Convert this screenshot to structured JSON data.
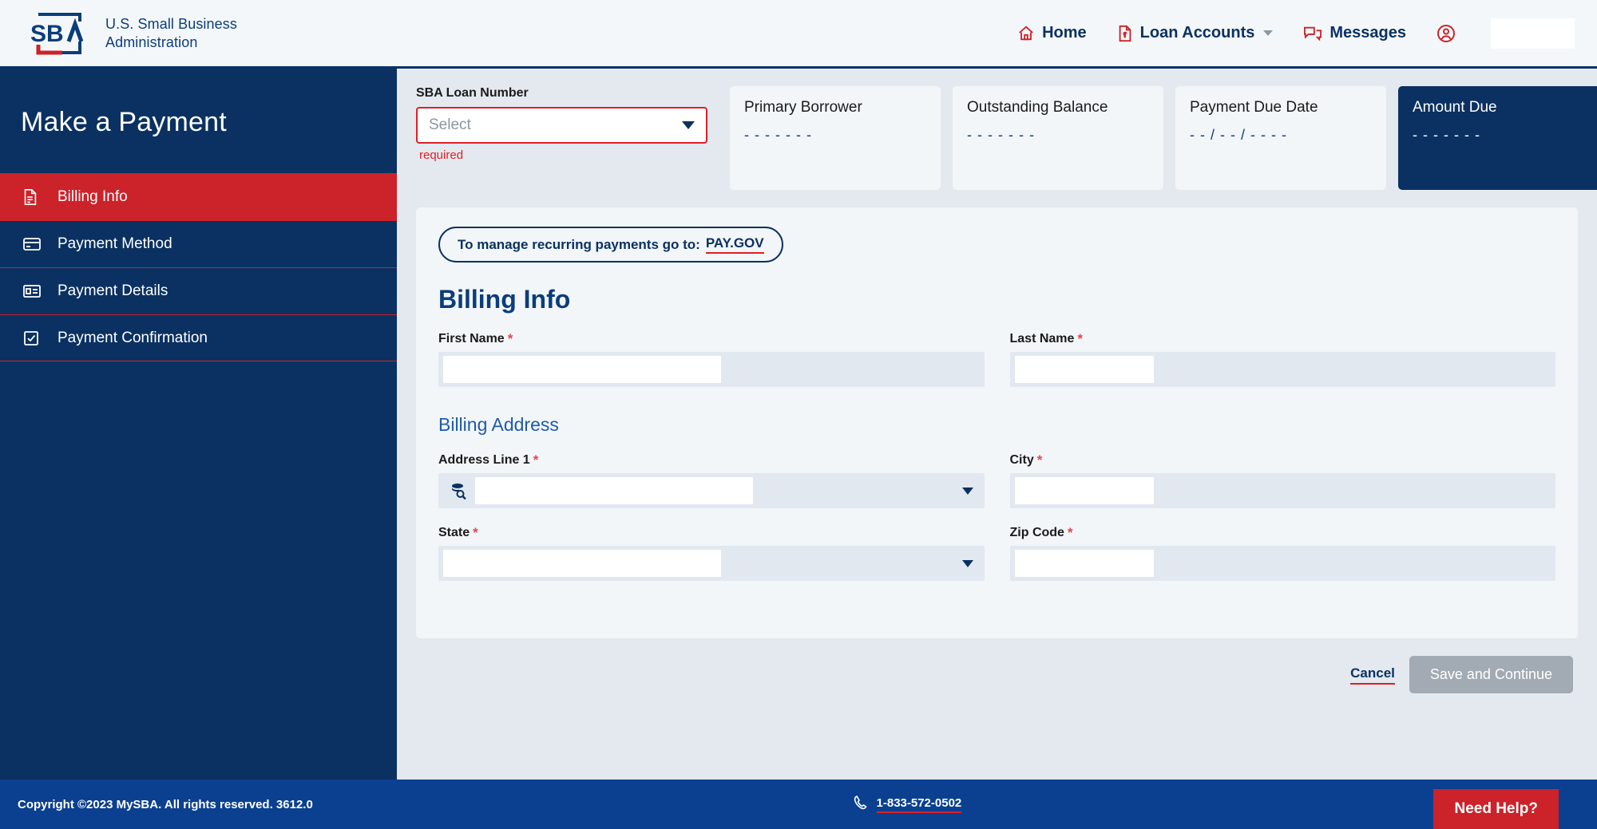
{
  "header": {
    "logo_alt": "SBA",
    "agency_line1": "U.S. Small Business",
    "agency_line2": "Administration",
    "nav": [
      {
        "label": "Home",
        "icon": "home-icon"
      },
      {
        "label": "Loan Accounts",
        "icon": "document-icon",
        "has_caret": true
      },
      {
        "label": "Messages",
        "icon": "messages-icon"
      }
    ],
    "user_name": ""
  },
  "sidebar": {
    "title": "Make a Payment",
    "items": [
      {
        "label": "Billing Info",
        "icon": "document-icon",
        "active": true
      },
      {
        "label": "Payment Method",
        "icon": "credit-card-icon",
        "active": false
      },
      {
        "label": "Payment Details",
        "icon": "payment-details-icon",
        "active": false
      },
      {
        "label": "Payment Confirmation",
        "icon": "checkbox-icon",
        "active": false
      }
    ]
  },
  "summary": {
    "loan_number_label": "SBA Loan Number",
    "loan_number_placeholder": "Select",
    "loan_number_error": "required",
    "cards": [
      {
        "title": "Primary Borrower",
        "value": "- - - - - - -"
      },
      {
        "title": "Outstanding Balance",
        "value": "- - - - - - -"
      },
      {
        "title": "Payment Due Date",
        "value": "- - / - - / - - - -"
      },
      {
        "title": "Amount Due",
        "value": "- - - - - - -",
        "dark": true
      }
    ]
  },
  "panel": {
    "recurring_notice_text": "To manage recurring payments go to:",
    "recurring_notice_link": "PAY.GOV",
    "heading": "Billing Info",
    "address_heading": "Billing Address",
    "fields": {
      "first_name": {
        "label": "First Name",
        "required": true,
        "value": ""
      },
      "last_name": {
        "label": "Last Name",
        "required": true,
        "value": ""
      },
      "address_line_1": {
        "label": "Address Line 1",
        "required": true,
        "value": ""
      },
      "city": {
        "label": "City",
        "required": true,
        "value": ""
      },
      "state": {
        "label": "State",
        "required": true,
        "value": ""
      },
      "zip_code": {
        "label": "Zip Code",
        "required": true,
        "value": ""
      }
    }
  },
  "actions": {
    "cancel_label": "Cancel",
    "save_label": "Save and Continue"
  },
  "footer": {
    "copyright": "Copyright ©2023 MySBA. All rights reserved. 3612.0",
    "phone": "1-833-572-0502",
    "need_help_label": "Need Help?"
  },
  "colors": {
    "navy": "#0a3161",
    "red": "#cc2229",
    "error_red": "#e01f26",
    "page_bg": "#e3e9ef",
    "card_bg": "#f2f6f9",
    "footer_navy": "#0b4091",
    "disabled_gray": "#a2abb3"
  }
}
